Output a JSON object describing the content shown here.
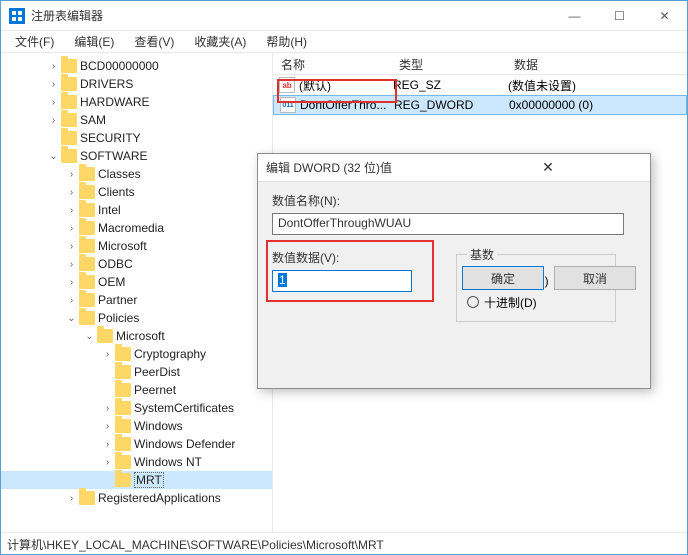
{
  "window": {
    "title": "注册表编辑器",
    "menus": [
      "文件(F)",
      "编辑(E)",
      "查看(V)",
      "收藏夹(A)",
      "帮助(H)"
    ]
  },
  "tree": {
    "items": [
      {
        "indent": 2,
        "exp": ">",
        "label": "BCD00000000"
      },
      {
        "indent": 2,
        "exp": ">",
        "label": "DRIVERS"
      },
      {
        "indent": 2,
        "exp": ">",
        "label": "HARDWARE"
      },
      {
        "indent": 2,
        "exp": ">",
        "label": "SAM"
      },
      {
        "indent": 2,
        "exp": "",
        "label": "SECURITY"
      },
      {
        "indent": 2,
        "exp": "v",
        "label": "SOFTWARE"
      },
      {
        "indent": 3,
        "exp": ">",
        "label": "Classes"
      },
      {
        "indent": 3,
        "exp": ">",
        "label": "Clients"
      },
      {
        "indent": 3,
        "exp": ">",
        "label": "Intel"
      },
      {
        "indent": 3,
        "exp": ">",
        "label": "Macromedia"
      },
      {
        "indent": 3,
        "exp": ">",
        "label": "Microsoft"
      },
      {
        "indent": 3,
        "exp": ">",
        "label": "ODBC"
      },
      {
        "indent": 3,
        "exp": ">",
        "label": "OEM"
      },
      {
        "indent": 3,
        "exp": ">",
        "label": "Partner"
      },
      {
        "indent": 3,
        "exp": "v",
        "label": "Policies"
      },
      {
        "indent": 4,
        "exp": "v",
        "label": "Microsoft"
      },
      {
        "indent": 5,
        "exp": ">",
        "label": "Cryptography"
      },
      {
        "indent": 5,
        "exp": "",
        "label": "PeerDist"
      },
      {
        "indent": 5,
        "exp": "",
        "label": "Peernet"
      },
      {
        "indent": 5,
        "exp": ">",
        "label": "SystemCertificates"
      },
      {
        "indent": 5,
        "exp": ">",
        "label": "Windows"
      },
      {
        "indent": 5,
        "exp": ">",
        "label": "Windows Defender"
      },
      {
        "indent": 5,
        "exp": ">",
        "label": "Windows NT"
      },
      {
        "indent": 5,
        "exp": "",
        "label": "MRT",
        "selected": true
      },
      {
        "indent": 3,
        "exp": ">",
        "label": "RegisteredApplications"
      }
    ]
  },
  "list": {
    "headers": {
      "name": "名称",
      "type": "类型",
      "data": "数据"
    },
    "rows": [
      {
        "icon": "sz",
        "name": "(默认)",
        "type": "REG_SZ",
        "data": "(数值未设置)"
      },
      {
        "icon": "dw",
        "name": "DontOfferThro...",
        "type": "REG_DWORD",
        "data": "0x00000000 (0)",
        "selected": true
      }
    ]
  },
  "dialog": {
    "title": "编辑 DWORD (32 位)值",
    "name_label": "数值名称(N):",
    "name_value": "DontOfferThroughWUAU",
    "data_label": "数值数据(V):",
    "data_value": "1",
    "base_legend": "基数",
    "radio_hex": "十六进制(H)",
    "radio_dec": "十进制(D)",
    "ok": "确定",
    "cancel": "取消"
  },
  "statusbar": "计算机\\HKEY_LOCAL_MACHINE\\SOFTWARE\\Policies\\Microsoft\\MRT"
}
